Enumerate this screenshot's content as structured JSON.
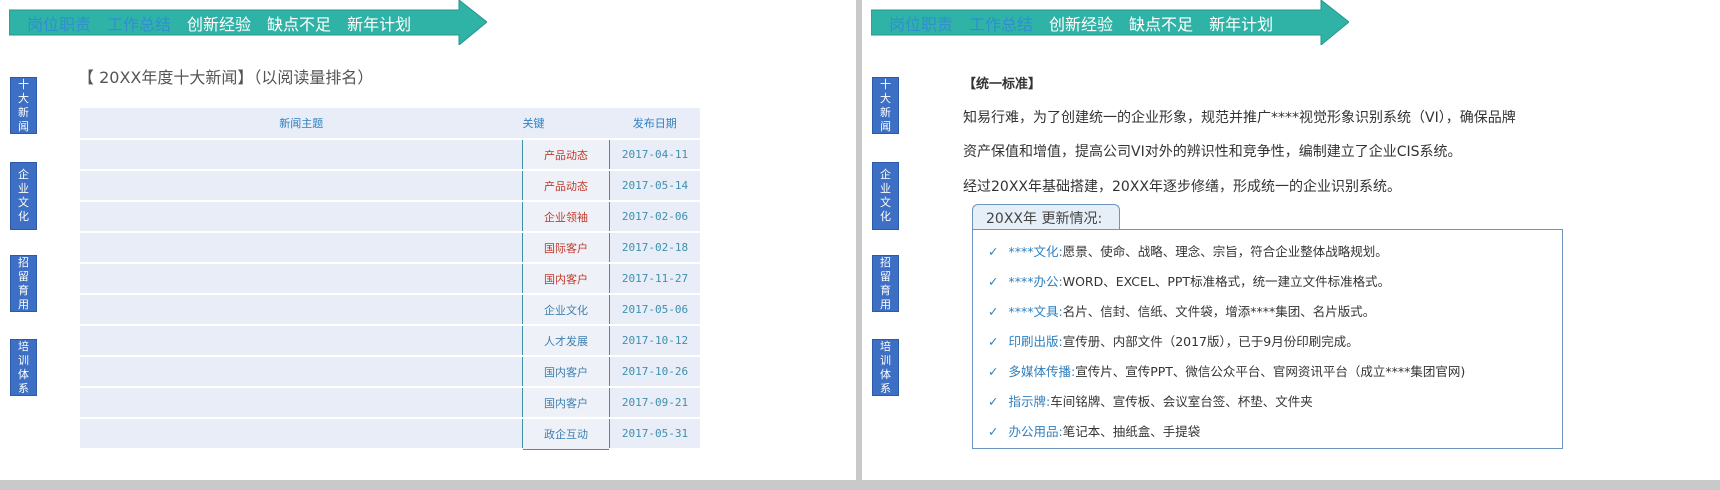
{
  "banner_tabs": [
    "岗位职责",
    "工作总结",
    "创新经验",
    "缺点不足",
    "新年计划"
  ],
  "side_tabs": [
    [
      "十",
      "大",
      "新",
      "闻"
    ],
    [
      "企",
      "业",
      "文",
      "化"
    ],
    [
      "招",
      "留",
      "育",
      "用"
    ],
    [
      "培",
      "训",
      "体",
      "系"
    ]
  ],
  "left": {
    "title": "【 20XX年度十大新闻】（以阅读量排名）",
    "headers": {
      "subject": "新闻主题",
      "key": "关键",
      "date": "发布日期"
    },
    "rows": [
      {
        "key": "产品动态",
        "date": "2017-04-11",
        "color": "red"
      },
      {
        "key": "产品动态",
        "date": "2017-05-14",
        "color": "red"
      },
      {
        "key": "企业领袖",
        "date": "2017-02-06",
        "color": "red"
      },
      {
        "key": "国际客户",
        "date": "2017-02-18",
        "color": "red"
      },
      {
        "key": "国内客户",
        "date": "2017-11-27",
        "color": "red"
      },
      {
        "key": "企业文化",
        "date": "2017-05-06",
        "color": "blue"
      },
      {
        "key": "人才发展",
        "date": "2017-10-12",
        "color": "blue"
      },
      {
        "key": "国内客户",
        "date": "2017-10-26",
        "color": "blue"
      },
      {
        "key": "国内客户",
        "date": "2017-09-21",
        "color": "blue"
      },
      {
        "key": "政企互动",
        "date": "2017-05-31",
        "color": "blue"
      }
    ]
  },
  "right": {
    "heading": "【统一标准】",
    "para1": "知易行难，为了创建统一的企业形象，规范并推广****视觉形象识别系统（VI），确保品牌",
    "para2": "资产保值和增值，提高公司VI对外的辨识性和竞争性，编制建立了企业CIS系统。",
    "para3": "经过20XX年基础搭建，20XX年逐步修缮，形成统一的企业识别系统。",
    "update_tab": "20XX年 更新情况:",
    "items": [
      {
        "label": "****文化:",
        "text": "愿景、使命、战略、理念、宗旨，符合企业整体战略规划。"
      },
      {
        "label": "****办公:",
        "text": "WORD、EXCEL、PPT标准格式，统一建立文件标准格式。"
      },
      {
        "label": "****文具:",
        "text": "名片、信封、信纸、文件袋，增添****集团、名片版式。"
      },
      {
        "label": "印刷出版:",
        "text": "宣传册、内部文件（2017版），已于9月份印刷完成。"
      },
      {
        "label": "多媒体传播:",
        "text": "宣传片、宣传PPT、微信公众平台、官网资讯平台（成立****集团官网)"
      },
      {
        "label": "指示牌:",
        "text": "车间铭牌、宣传板、会议室台签、杯垫、文件夹"
      },
      {
        "label": "办公用品:",
        "text": "笔记本、抽纸盒、手提袋"
      }
    ],
    "check_glyph": "✓"
  },
  "colors": {
    "banner": "#2fb3a6",
    "accent": "#2f80c0",
    "side_tab": "#3d6fc4",
    "red_key": "#c0392b"
  }
}
